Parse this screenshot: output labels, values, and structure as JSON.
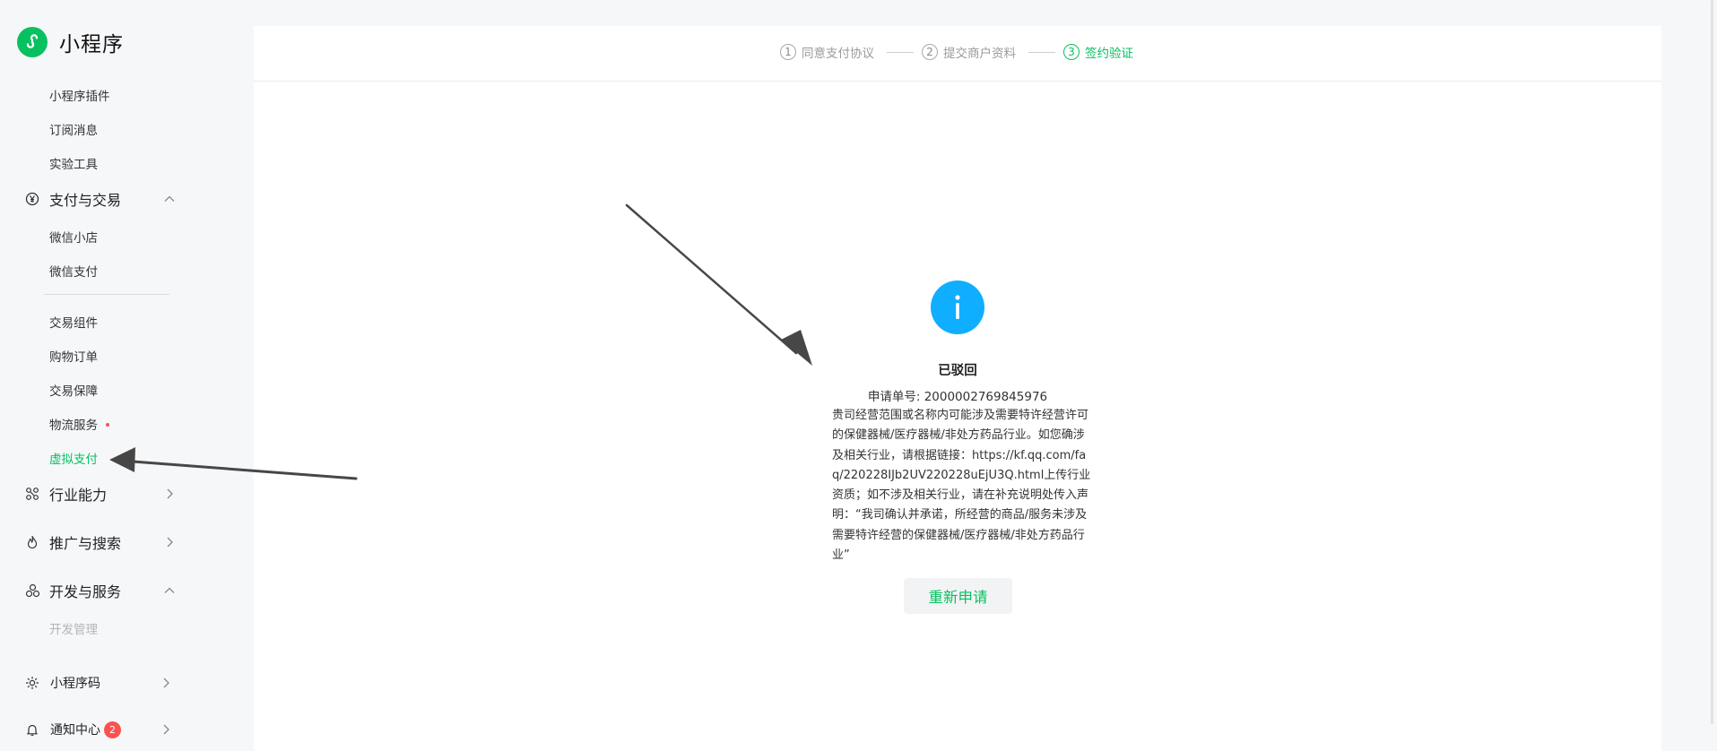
{
  "app": {
    "name": "小程序"
  },
  "sidebar": {
    "top_items": [
      {
        "label": "小程序插件"
      },
      {
        "label": "订阅消息"
      },
      {
        "label": "实验工具"
      }
    ],
    "payment_group": {
      "label": "支付与交易",
      "icon": "yen-icon",
      "expanded": true
    },
    "payment_items": [
      {
        "label": "微信小店"
      },
      {
        "label": "微信支付"
      },
      {
        "label": "交易组件"
      },
      {
        "label": "购物订单"
      },
      {
        "label": "交易保障"
      },
      {
        "label": "物流服务",
        "has_dot": true
      },
      {
        "label": "虚拟支付",
        "active": true
      }
    ],
    "industry_group": {
      "label": "行业能力",
      "icon": "nodes-icon"
    },
    "promo_group": {
      "label": "推广与搜索",
      "icon": "flame-icon"
    },
    "dev_group": {
      "label": "开发与服务",
      "icon": "cluster-icon",
      "expanded": true
    },
    "dev_items": [
      {
        "label": "开发管理"
      }
    ],
    "qrcode_group": {
      "label": "小程序码",
      "icon": "sun-icon"
    },
    "notify_group": {
      "label": "通知中心",
      "icon": "bell-icon",
      "badge": "2"
    }
  },
  "steps": [
    {
      "num": "1",
      "label": "同意支付协议"
    },
    {
      "num": "2",
      "label": "提交商户资料"
    },
    {
      "num": "3",
      "label": "签约验证",
      "active": true
    }
  ],
  "status": {
    "icon": "info-icon",
    "title": "已驳回",
    "order_line": "申请单号: 2000002769845976",
    "description": "贵司经营范围或名称内可能涉及需要特许经营许可的保健器械/医疗器械/非处方药品行业。如您确涉及相关行业，请根据链接：https://kf.qq.com/faq/220228IJb2UV220228uEjU3Q.html上传行业资质；如不涉及相关行业，请在补充说明处传入声明：“我司确认并承诺，所经营的商品/服务未涉及需要特许经营的保健器械/医疗器械/非处方药品行业”",
    "button_label": "重新申请"
  },
  "colors": {
    "brand_green": "#07c160",
    "info_blue": "#10aeff",
    "badge_red": "#fa5151",
    "sidebar_bg": "#f6f7f9"
  }
}
